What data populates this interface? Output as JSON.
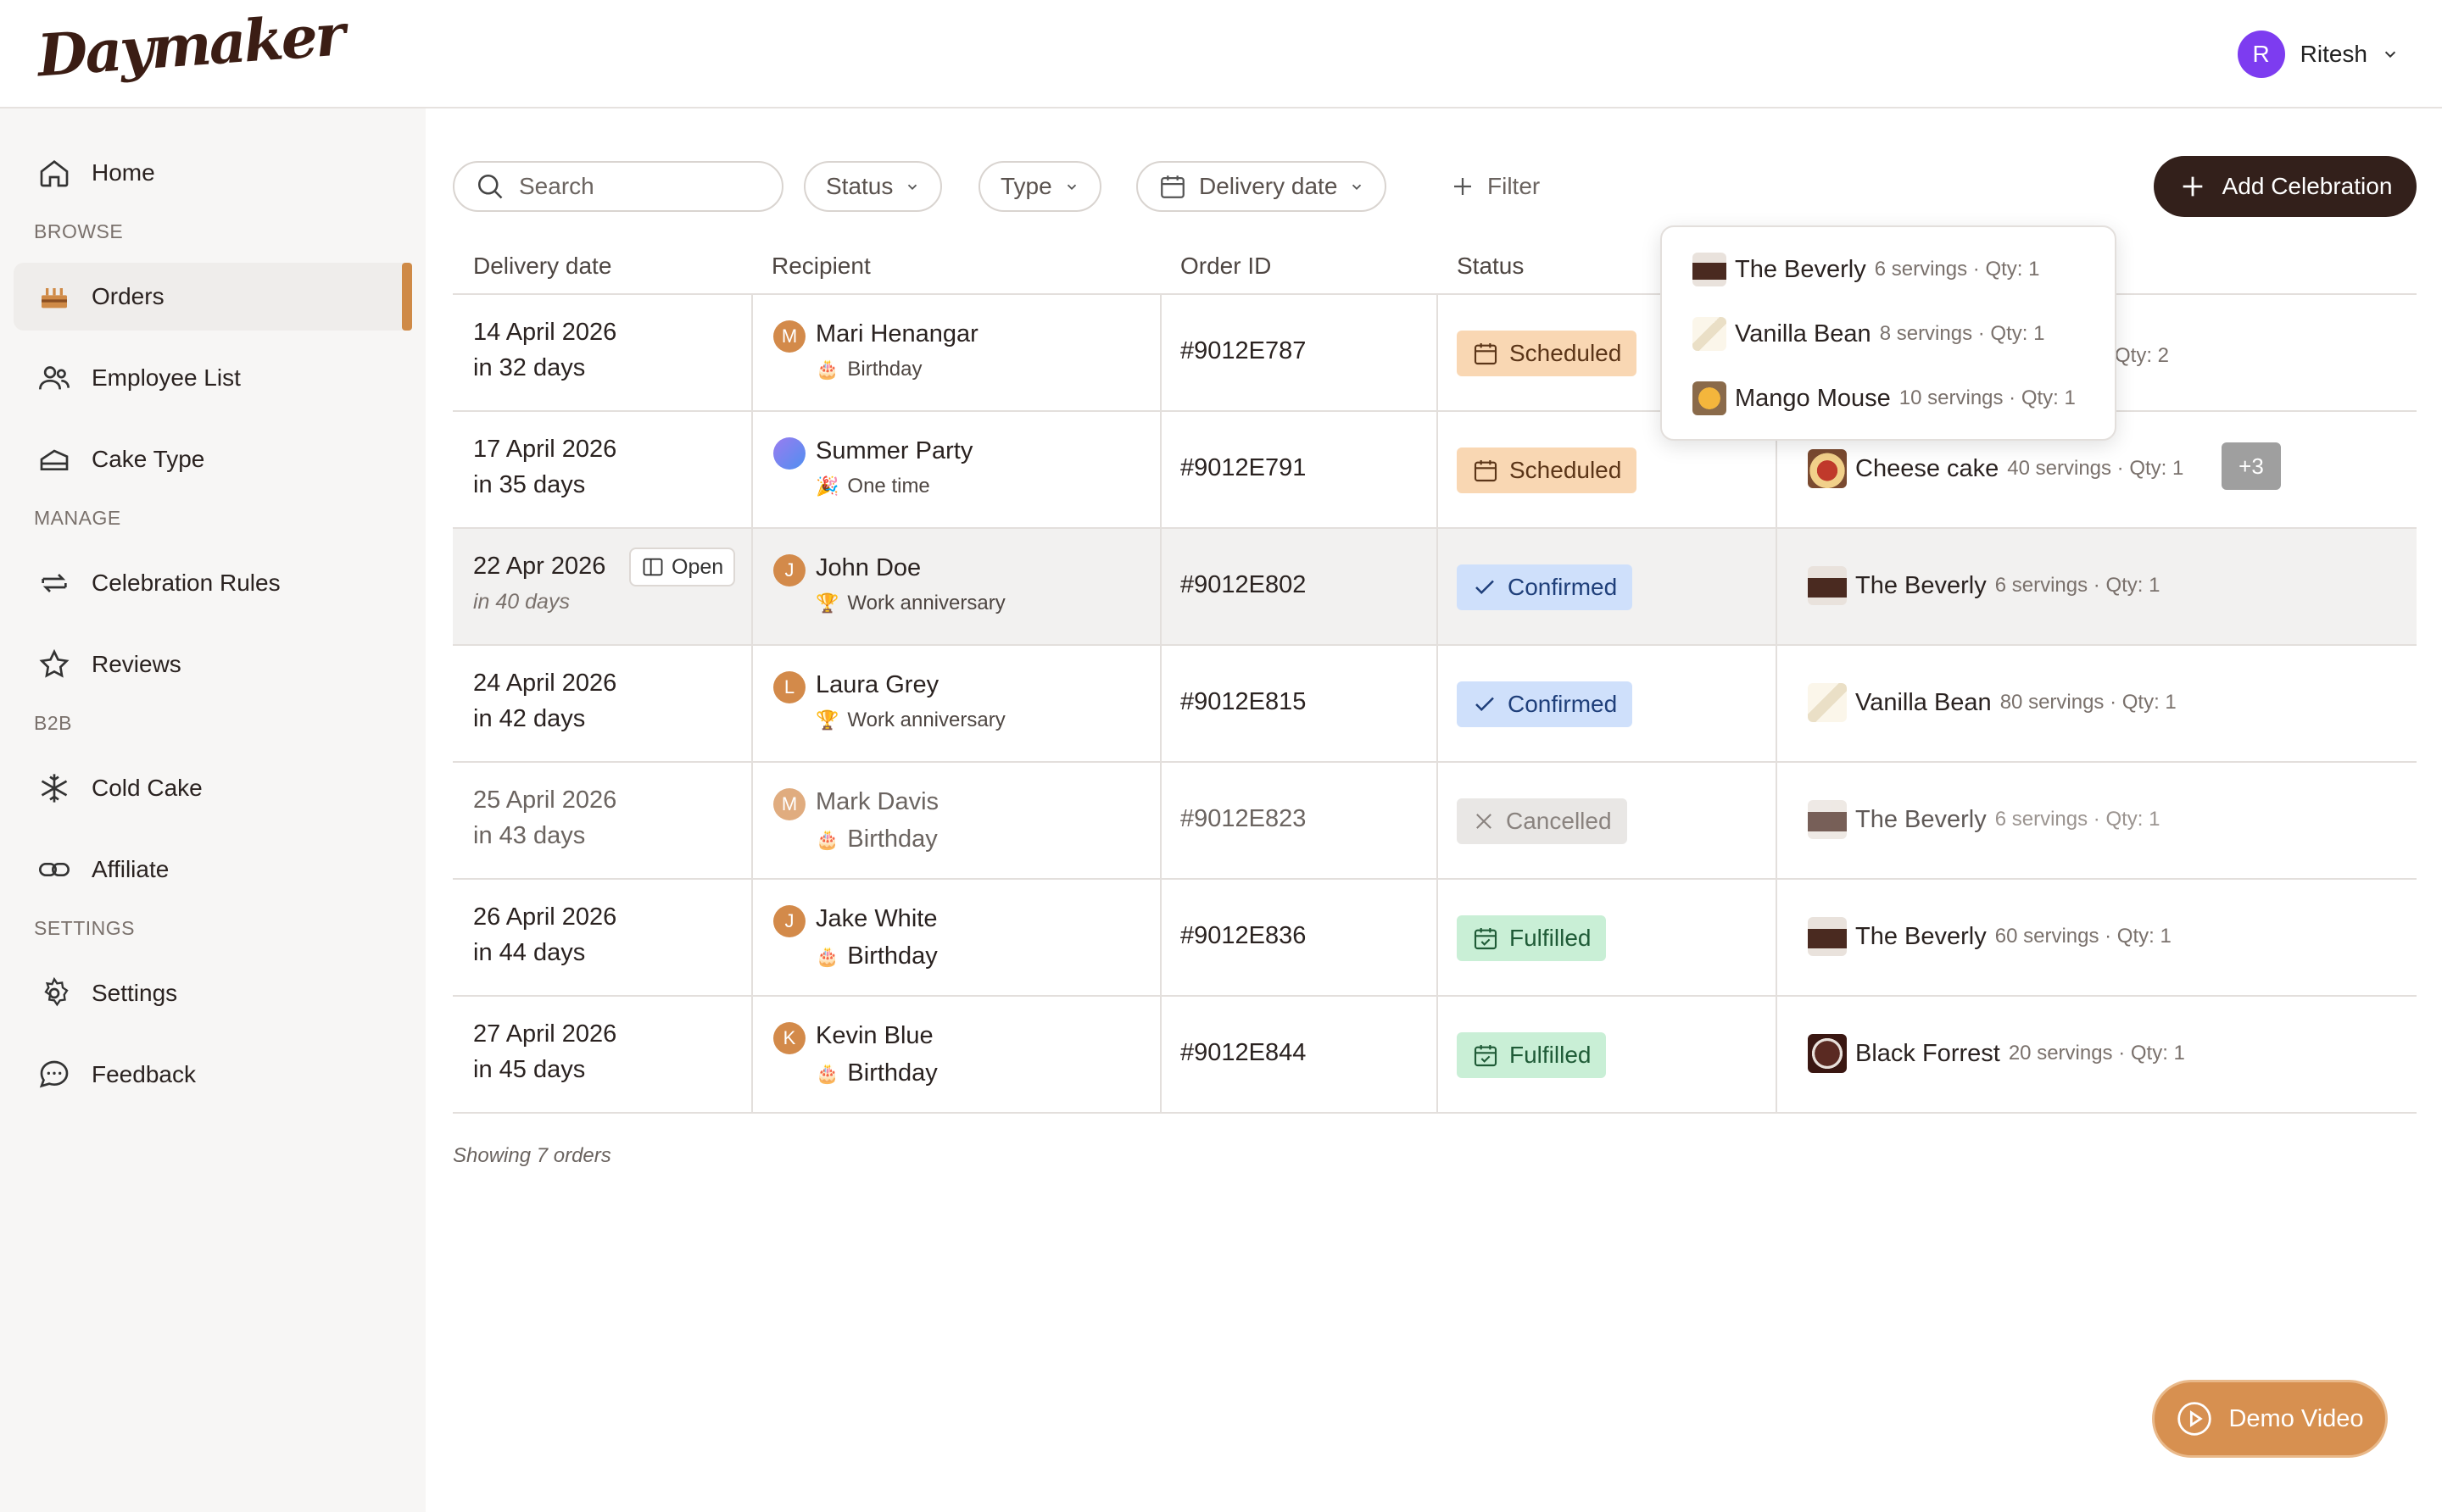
{
  "app": {
    "logo": "Daymaker"
  },
  "user": {
    "initial": "R",
    "name": "Ritesh",
    "avatar_color": "#7d3cf0"
  },
  "sidebar": {
    "home": "Home",
    "browse_label": "BROWSE",
    "orders": "Orders",
    "employee_list": "Employee List",
    "cake_type": "Cake Type",
    "manage_label": "MANAGE",
    "celebration_rules": "Celebration Rules",
    "reviews": "Reviews",
    "b2b_label": "B2B",
    "cold_cake": "Cold Cake",
    "affiliate": "Affiliate",
    "settings_label": "SETTINGS",
    "settings": "Settings",
    "feedback": "Feedback"
  },
  "toolbar": {
    "search_placeholder": "Search",
    "status": "Status",
    "type": "Type",
    "delivery_date": "Delivery date",
    "filter": "Filter",
    "add_celebration": "Add Celebration"
  },
  "table": {
    "headers": {
      "delivery_date": "Delivery date",
      "recipient": "Recipient",
      "order_id": "Order ID",
      "status": "Status"
    },
    "rows": [
      {
        "date": "14 April 2026",
        "sub": "in 32 days",
        "initial": "M",
        "name": "Mari Henangar",
        "type": "Birthday",
        "order_id": "#9012E787",
        "status": "Scheduled",
        "product": "",
        "product_meta": "Qty: 2"
      },
      {
        "date": "17 April 2026",
        "sub": "in 35 days",
        "initial": "",
        "name": "Summer Party",
        "type": "One time",
        "order_id": "#9012E791",
        "status": "Scheduled",
        "product": "Cheese cake",
        "product_meta": "40 servings · Qty: 1",
        "extra": "+3"
      },
      {
        "date": "22 Apr 2026",
        "sub": "in 40 days",
        "open": "Open",
        "initial": "J",
        "name": "John Doe",
        "type": "Work anniversary",
        "order_id": "#9012E802",
        "status": "Confirmed",
        "product": "The Beverly",
        "product_meta": "6 servings · Qty: 1"
      },
      {
        "date": "24 April 2026",
        "sub": "in 42 days",
        "initial": "L",
        "name": "Laura Grey",
        "type": "Work anniversary",
        "order_id": "#9012E815",
        "status": "Confirmed",
        "product": "Vanilla Bean",
        "product_meta": "80 servings · Qty: 1"
      },
      {
        "date": "25 April 2026",
        "sub": "in 43 days",
        "initial": "M",
        "name": "Mark Davis",
        "type": "Birthday",
        "order_id": "#9012E823",
        "status": "Cancelled",
        "product": "The Beverly",
        "product_meta": "6 servings · Qty: 1"
      },
      {
        "date": "26 April 2026",
        "sub": "in 44 days",
        "initial": "J",
        "name": "Jake White",
        "type": "Birthday",
        "order_id": "#9012E836",
        "status": "Fulfilled",
        "product": "The Beverly",
        "product_meta": "60 servings · Qty: 1"
      },
      {
        "date": "27 April 2026",
        "sub": "in 45 days",
        "initial": "K",
        "name": "Kevin Blue",
        "type": "Birthday",
        "order_id": "#9012E844",
        "status": "Fulfilled",
        "product": "Black Forrest",
        "product_meta": "20 servings · Qty: 1"
      }
    ],
    "footer": "Showing 7 orders"
  },
  "popover": {
    "items": [
      {
        "name": "The Beverly",
        "meta": "6 servings · Qty: 1"
      },
      {
        "name": "Vanilla Bean",
        "meta": "8 servings · Qty: 1"
      },
      {
        "name": "Mango Mouse",
        "meta": "10 servings · Qty: 1"
      }
    ]
  },
  "demo_video": "Demo Video",
  "colors": {
    "accent": "#cf8a47",
    "dark": "#33201b"
  }
}
